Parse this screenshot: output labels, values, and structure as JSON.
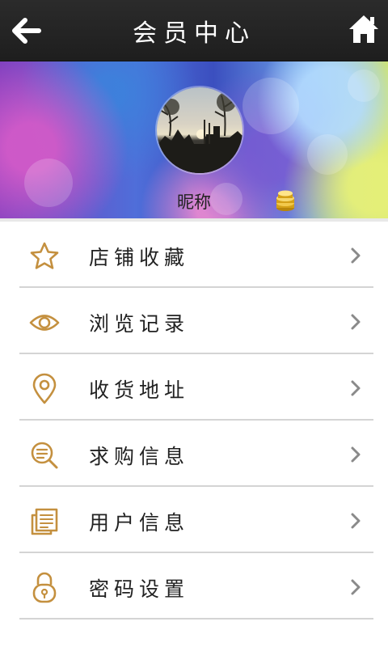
{
  "header": {
    "title": "会员中心",
    "back_icon": "back-arrow-icon",
    "home_icon": "home-icon"
  },
  "profile": {
    "nickname": "昵称",
    "badge_icon": "gold-coins-icon"
  },
  "colors": {
    "accent": "#c4903f",
    "topbar": "#222222",
    "divider": "#d4d4d4",
    "chevron": "#8a8a8a"
  },
  "menu": {
    "items": [
      {
        "label": "店铺收藏",
        "icon": "star-icon"
      },
      {
        "label": "浏览记录",
        "icon": "eye-icon"
      },
      {
        "label": "收货地址",
        "icon": "location-pin-icon"
      },
      {
        "label": "求购信息",
        "icon": "search-list-icon"
      },
      {
        "label": "用户信息",
        "icon": "document-icon"
      },
      {
        "label": "密码设置",
        "icon": "lock-icon"
      }
    ]
  }
}
